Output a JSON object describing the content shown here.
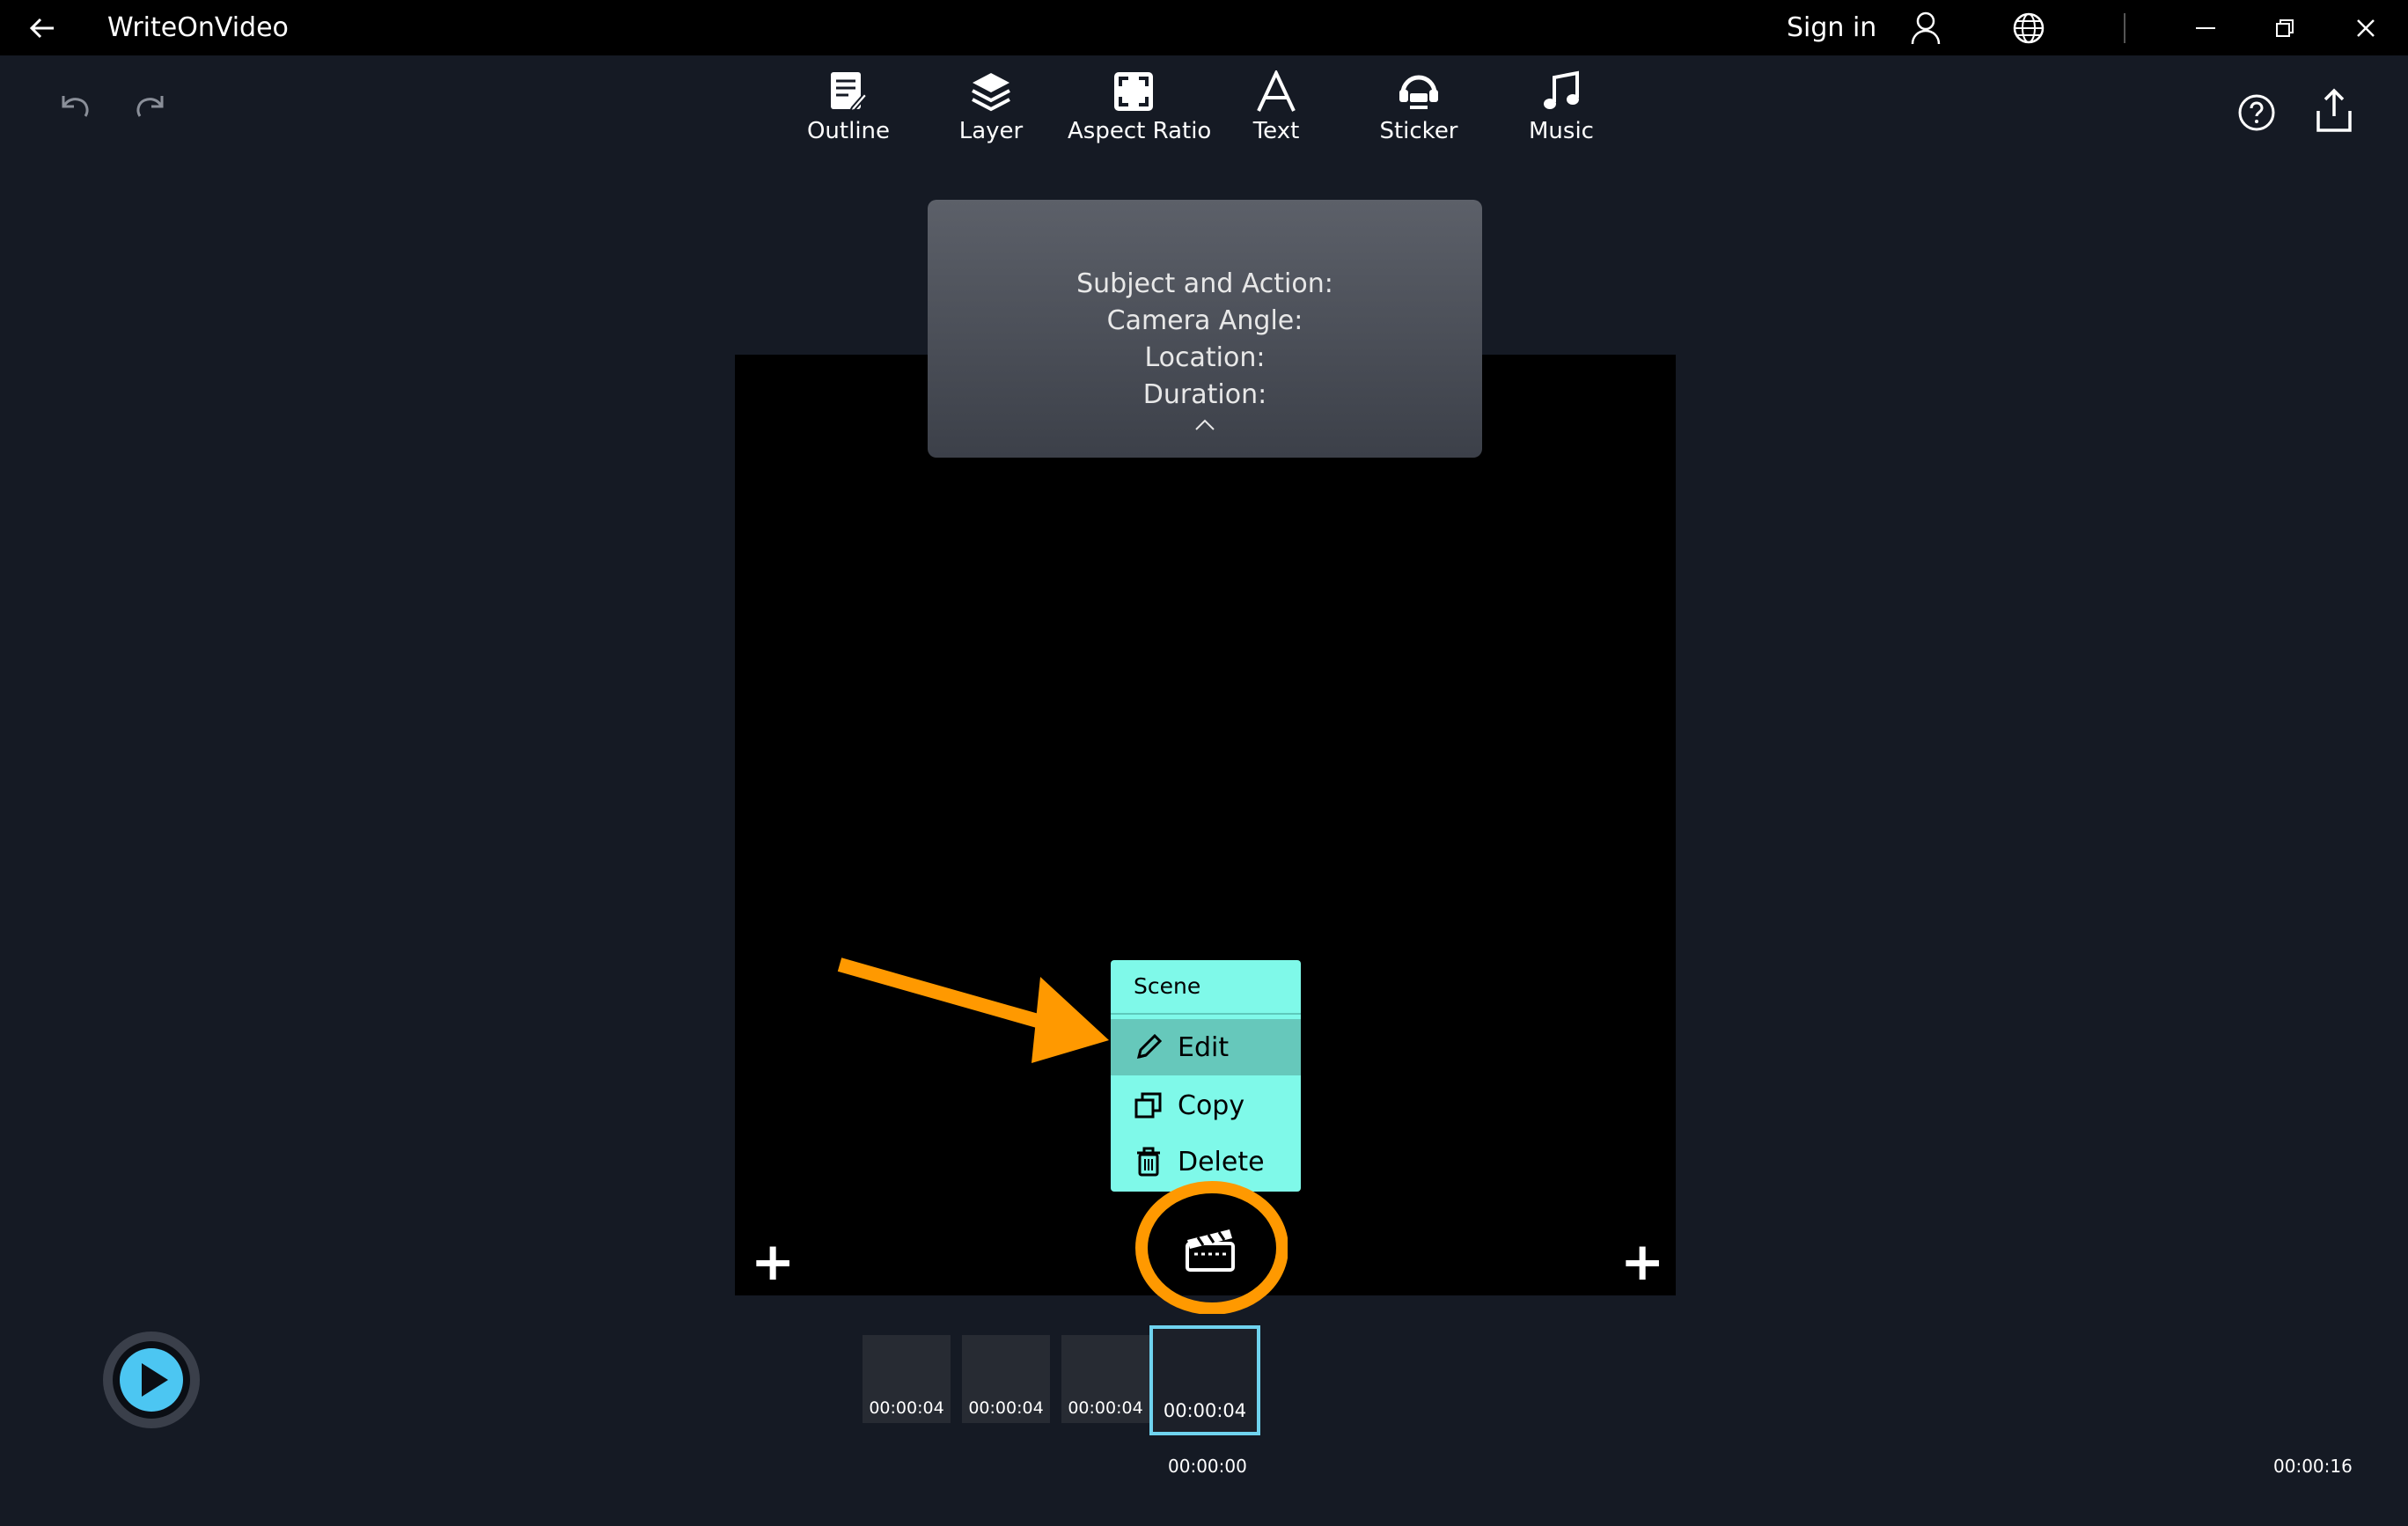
{
  "app": {
    "title": "WriteOnVideo",
    "sign_in": "Sign in"
  },
  "toolbar": {
    "items": [
      {
        "label": "Outline",
        "icon": "outline-icon"
      },
      {
        "label": "Layer",
        "icon": "layer-icon"
      },
      {
        "label": "Aspect Ratio",
        "icon": "aspect-ratio-icon"
      },
      {
        "label": "Text",
        "icon": "text-icon"
      },
      {
        "label": "Sticker",
        "icon": "sticker-icon"
      },
      {
        "label": "Music",
        "icon": "music-icon"
      }
    ]
  },
  "outline_panel": {
    "lines": [
      "Subject and Action:",
      "Camera Angle:",
      "Location:",
      "Duration:"
    ]
  },
  "context_menu": {
    "header": "Scene",
    "items": [
      {
        "label": "Edit",
        "icon": "pencil-icon",
        "highlighted": true
      },
      {
        "label": "Copy",
        "icon": "copy-icon"
      },
      {
        "label": "Delete",
        "icon": "trash-icon"
      }
    ]
  },
  "timeline": {
    "scenes": [
      {
        "duration": "00:00:04"
      },
      {
        "duration": "00:00:04"
      },
      {
        "duration": "00:00:04"
      },
      {
        "duration": "00:00:04",
        "selected": true
      }
    ],
    "current_time": "00:00:00",
    "total_time": "00:00:16"
  },
  "colors": {
    "background": "#151a24",
    "menu": "#7ff9e9",
    "menu_highlight": "#66c8bb",
    "annotation": "#ff9900",
    "selection": "#6fd3ef"
  }
}
